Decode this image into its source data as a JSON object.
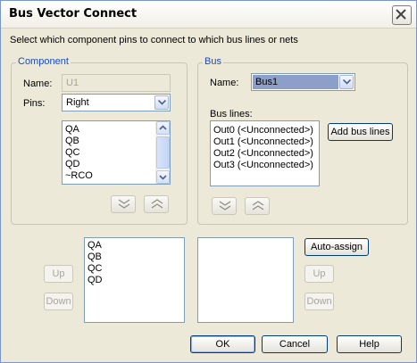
{
  "window": {
    "title": "Bus Vector Connect"
  },
  "instruction": "Select which component pins to connect to which bus lines or nets",
  "component": {
    "group_label": "Component",
    "name_label": "Name:",
    "name_value": "U1",
    "pins_label": "Pins:",
    "pins_value": "Right",
    "pins_list": [
      "QA",
      "QB",
      "QC",
      "QD",
      "~RCO",
      "~"
    ]
  },
  "bus": {
    "group_label": "Bus",
    "name_label": "Name:",
    "name_value": "Bus1",
    "lines_label": "Bus lines:",
    "lines": [
      "Out0 (<Unconnected>)",
      "Out1 (<Unconnected>)",
      "Out2 (<Unconnected>)",
      "Out3 (<Unconnected>)"
    ],
    "add_button": "Add bus lines"
  },
  "selected_pins": [
    "QA",
    "QB",
    "QC",
    "QD"
  ],
  "buttons": {
    "up": "Up",
    "down": "Down",
    "auto_assign": "Auto-assign",
    "ok": "OK",
    "cancel": "Cancel",
    "help": "Help"
  },
  "icons": {
    "close": "close-icon",
    "move_down": "double-chevron-down-icon",
    "move_up": "double-chevron-up-icon",
    "dropdown": "chevron-down-icon"
  }
}
